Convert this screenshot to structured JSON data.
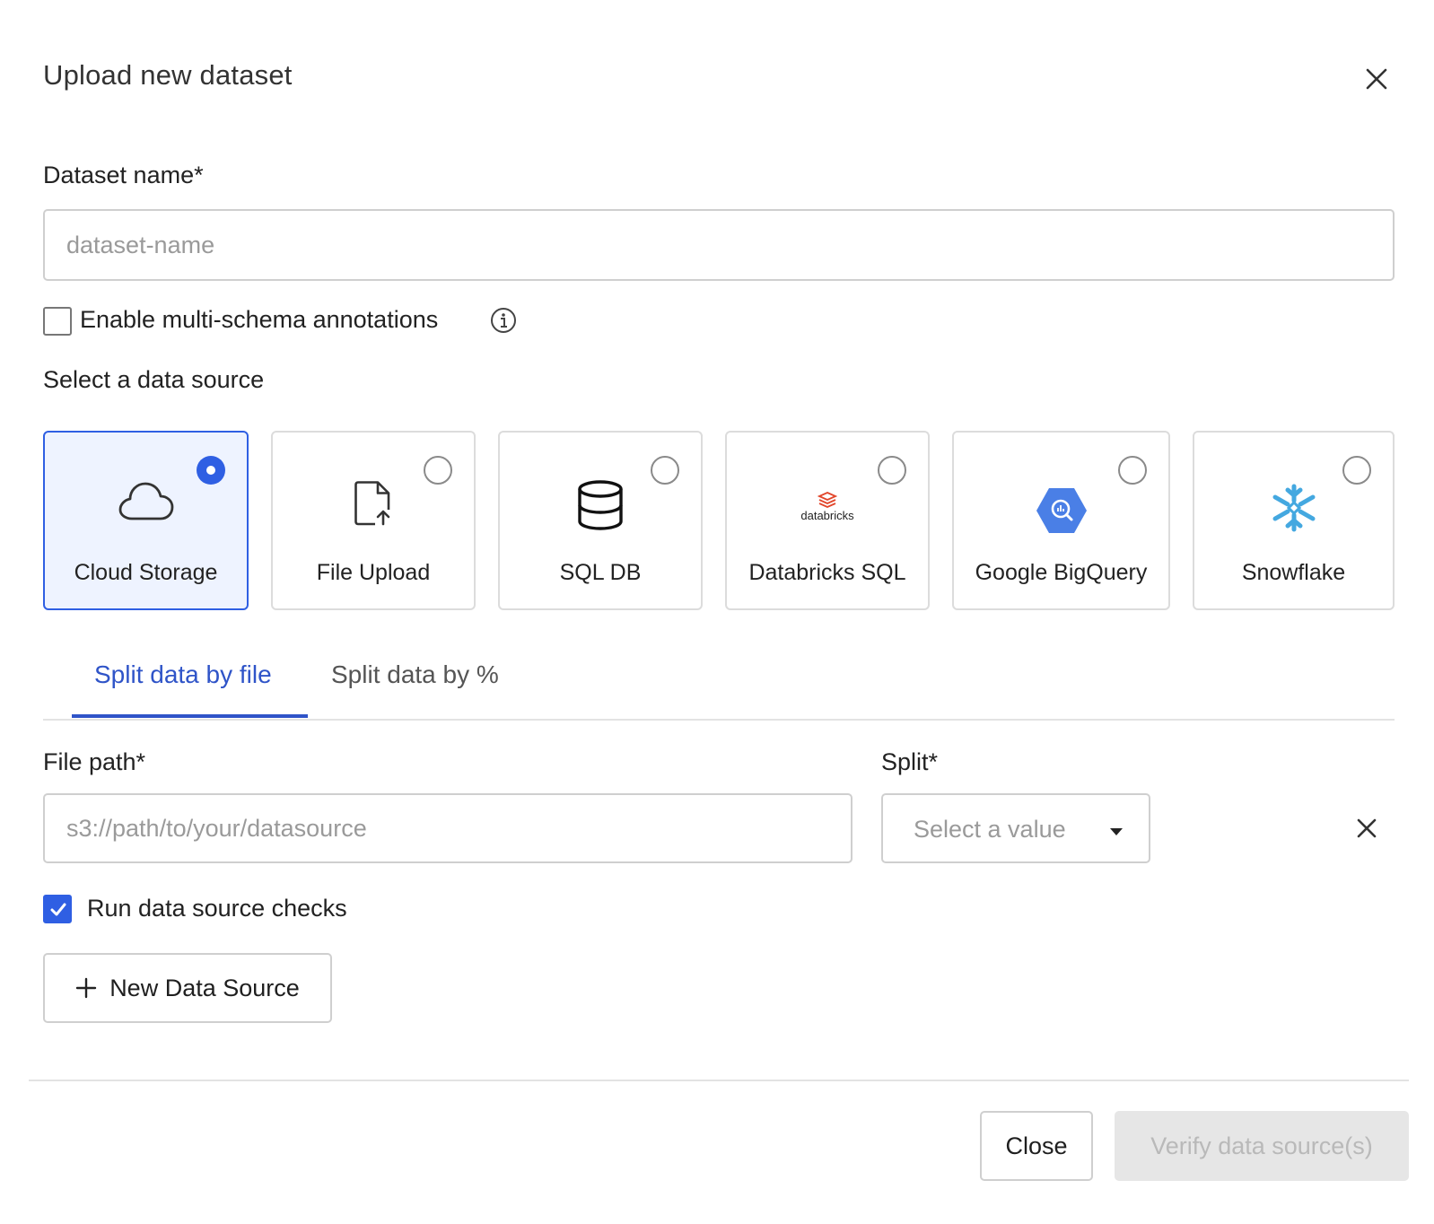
{
  "dialog": {
    "title": "Upload new dataset"
  },
  "dataset": {
    "name_label": "Dataset name*",
    "name_placeholder": "dataset-name",
    "name_value": ""
  },
  "multi_schema": {
    "label": "Enable multi-schema annotations",
    "checked": false
  },
  "data_source": {
    "heading": "Select a data source",
    "options": [
      {
        "label": "Cloud Storage",
        "icon": "cloud-icon",
        "selected": true
      },
      {
        "label": "File Upload",
        "icon": "file-upload-icon",
        "selected": false
      },
      {
        "label": "SQL DB",
        "icon": "database-icon",
        "selected": false
      },
      {
        "label": "Databricks SQL",
        "icon": "databricks-logo",
        "logo_text": "databricks",
        "selected": false
      },
      {
        "label": "Google BigQuery",
        "icon": "bigquery-logo",
        "selected": false
      },
      {
        "label": "Snowflake",
        "icon": "snowflake-logo",
        "selected": false
      }
    ]
  },
  "tabs": [
    {
      "label": "Split data by file",
      "active": true
    },
    {
      "label": "Split data by %",
      "active": false
    }
  ],
  "file_row": {
    "path_label": "File path*",
    "path_placeholder": "s3://path/to/your/datasource",
    "path_value": "",
    "split_label": "Split*",
    "split_placeholder": "Select a value"
  },
  "checks": {
    "label": "Run data source checks",
    "checked": true
  },
  "new_source_button": "New Data Source",
  "footer": {
    "close_label": "Close",
    "verify_label": "Verify data source(s)"
  },
  "colors": {
    "accent": "#2f5fe3",
    "tab_active": "#2f54c8",
    "selected_card_bg": "#eef3ff",
    "databricks": "#e2462b",
    "bigquery": "#4a7fe6",
    "snowflake": "#44a8e0"
  }
}
